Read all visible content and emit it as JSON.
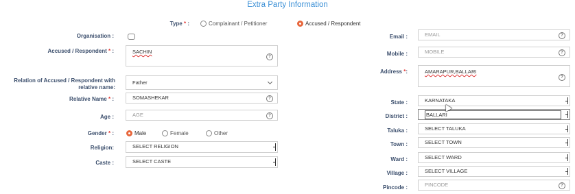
{
  "title": "Extra Party Information",
  "type": {
    "label": "Type",
    "options": [
      "Complainant / Petitioner",
      "Accused / Respondent"
    ],
    "selected": "Accused / Respondent"
  },
  "left": {
    "organisation_label": "Organisation :",
    "accused_label": "Accused / Respondent",
    "accused_value": "SACHIN",
    "relation_label": "Relation of Accused / Respondent with relative name:",
    "relation_value": "Father",
    "relative_name_label": "Relative Name",
    "relative_name_value": "SOMASHEKAR",
    "age_label": "Age :",
    "age_placeholder": "AGE",
    "gender_label": "Gender",
    "gender_options": [
      "Male",
      "Female",
      "Other"
    ],
    "gender_selected": "Male",
    "religion_label": "Religion:",
    "religion_value": "SELECT RELIGION",
    "caste_label": "Caste :",
    "caste_value": "SELECT CASTE"
  },
  "right": {
    "email_label": "Email :",
    "email_placeholder": "EMAIL",
    "mobile_label": "Mobile :",
    "mobile_placeholder": "MOBILE",
    "address_label": "Address",
    "address_value": "AMARAPUR,BALLARI",
    "state_label": "State :",
    "state_value": "KARNATAKA",
    "district_label": "District :",
    "district_value": "BALLARI",
    "taluka_label": "Taluka :",
    "taluka_value": "SELECT TALUKA",
    "town_label": "Town :",
    "town_value": "SELECT TOWN",
    "ward_label": "Ward :",
    "ward_value": "SELECT WARD",
    "village_label": "Village :",
    "village_value": "SELECT VILLAGE",
    "pincode_label": "Pincode :",
    "pincode_placeholder": "PINCODE"
  },
  "icons": {
    "help": "question-circle-icon",
    "required_marker": "*",
    "required_color": "#e53935",
    "accent_color": "#3a8fd6",
    "radio_selected_color": "#e8663b"
  }
}
